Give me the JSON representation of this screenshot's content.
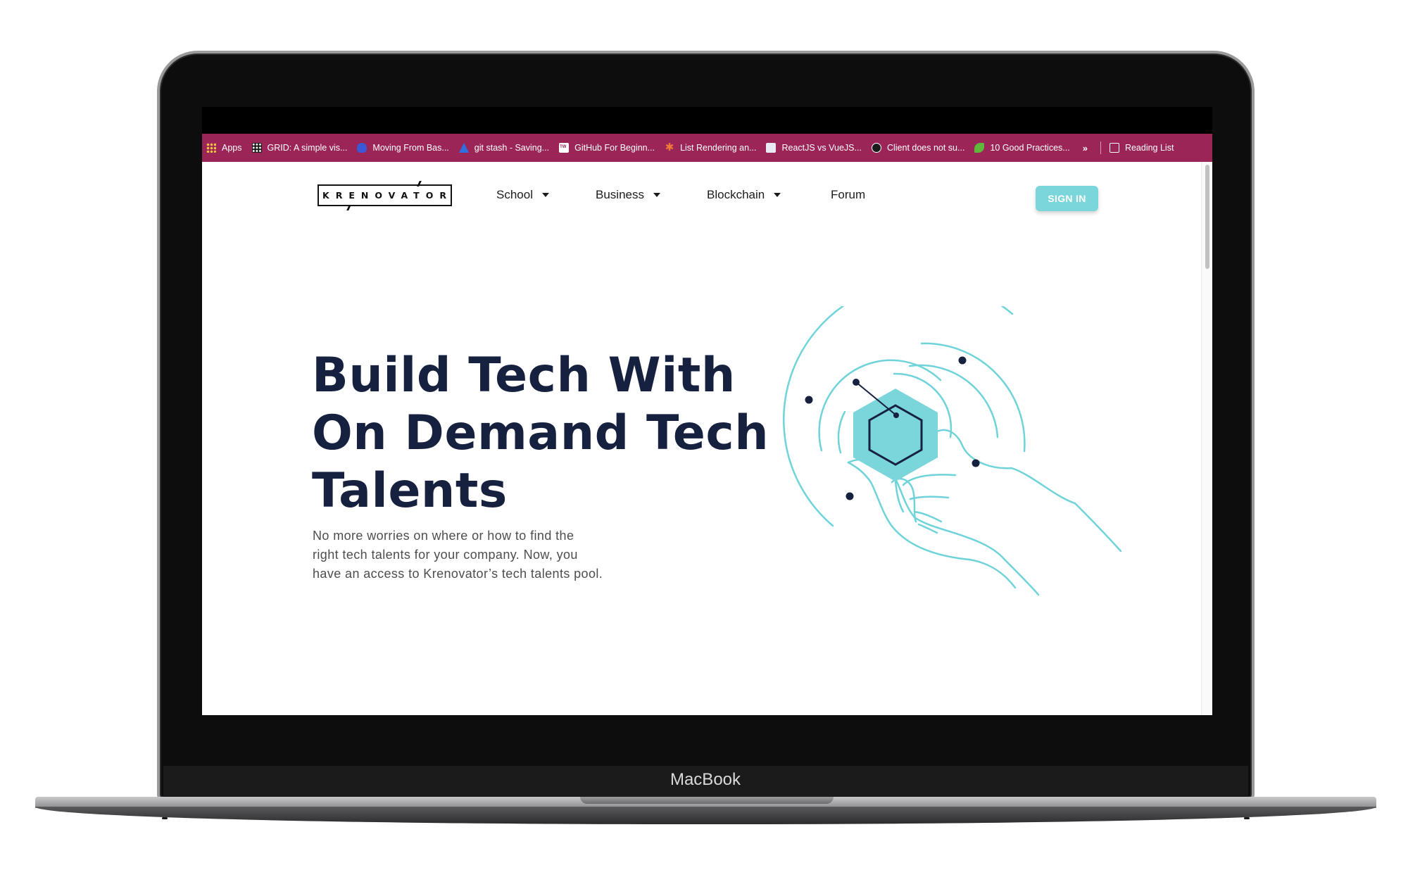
{
  "device": {
    "label": "MacBook"
  },
  "bookmarks_bar": {
    "items": [
      {
        "label": "Apps",
        "icon": "apps-grid-icon"
      },
      {
        "label": "GRID: A simple vis...",
        "icon": "grid-icon"
      },
      {
        "label": "Moving From Bas...",
        "icon": "rocket-icon"
      },
      {
        "label": "git stash - Saving...",
        "icon": "atlassian-icon"
      },
      {
        "label": "GitHub For Beginn...",
        "icon": "tw-icon"
      },
      {
        "label": "List Rendering an...",
        "icon": "asterisk-icon"
      },
      {
        "label": "ReactJS vs VueJS...",
        "icon": "rv-icon"
      },
      {
        "label": "Client does not su...",
        "icon": "github-icon"
      },
      {
        "label": "10 Good Practices...",
        "icon": "leaf-icon"
      }
    ],
    "more_label": "»",
    "reading_list_label": "Reading List"
  },
  "navbar": {
    "logo_text": "KRENOVATOR",
    "links": [
      {
        "label": "School",
        "has_dropdown": true
      },
      {
        "label": "Business",
        "has_dropdown": true
      },
      {
        "label": "Blockchain",
        "has_dropdown": true
      },
      {
        "label": "Forum",
        "has_dropdown": false
      }
    ],
    "signin_label": "SIGN IN"
  },
  "hero": {
    "title_lines": [
      "Build Tech With",
      "On Demand Tech",
      "Talents"
    ],
    "subtitle_lines": [
      "No more worries on where or how to find the",
      "right tech talents for your company. Now, you",
      "have an access to Krenovator’s tech talents pool."
    ]
  },
  "colors": {
    "bookmark_bar": "#9b2557",
    "title": "#16213f",
    "accent": "#7bd6dc",
    "line_art": "#6fd3da",
    "node": "#16213f"
  }
}
